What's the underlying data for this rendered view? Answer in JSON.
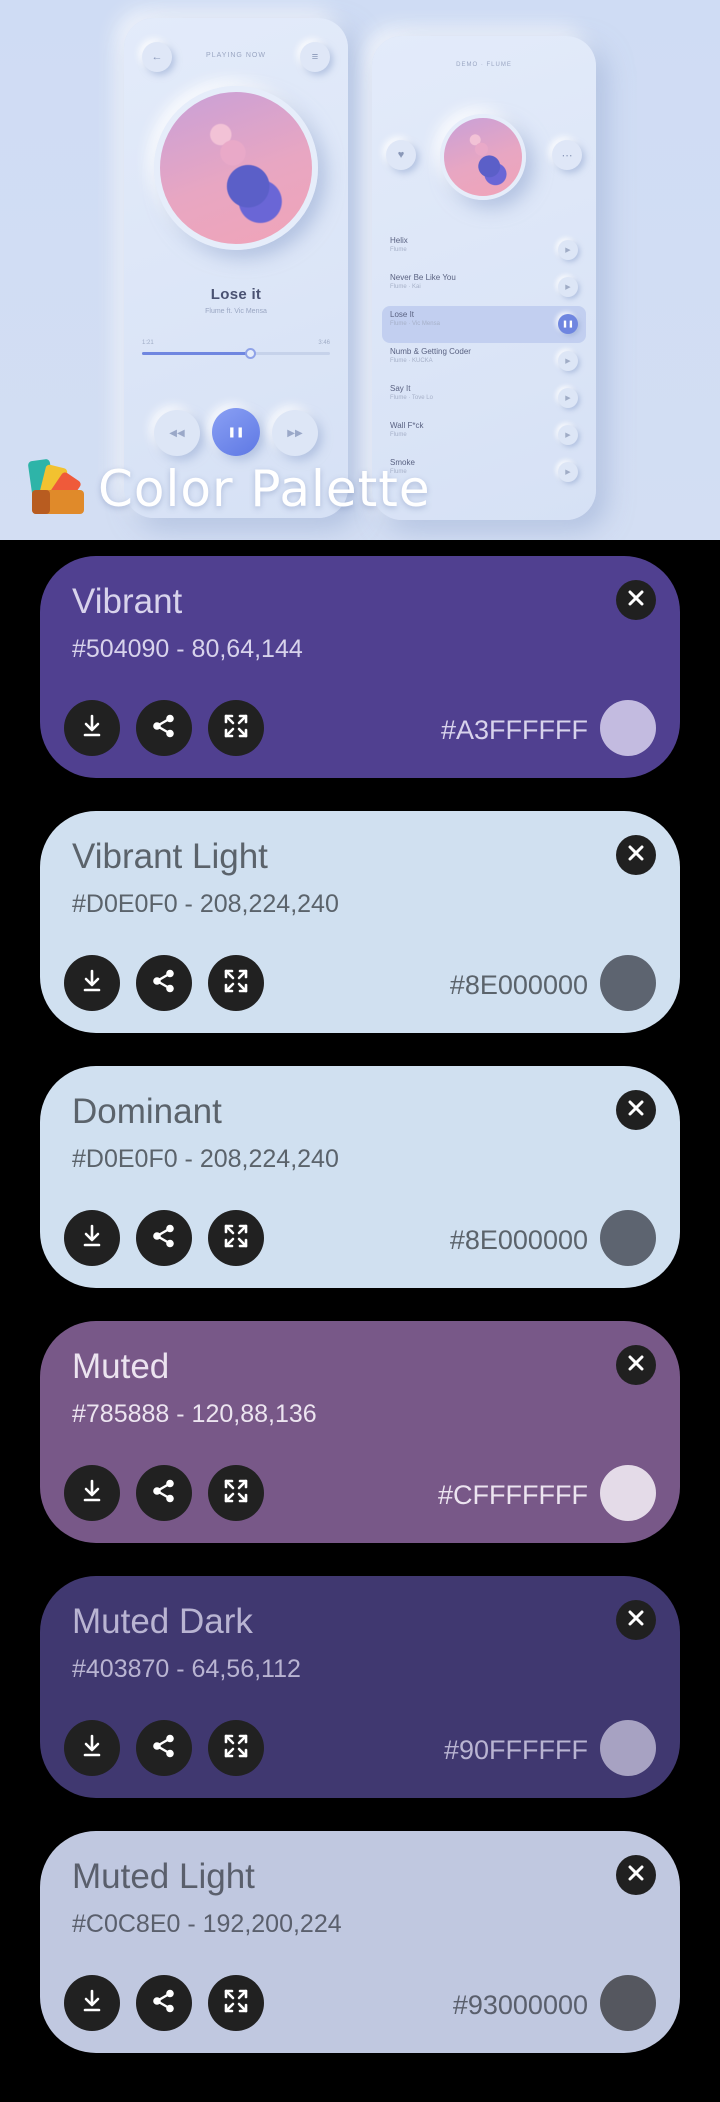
{
  "hero": {
    "now_playing_title": "PLAYING NOW",
    "song": "Lose it",
    "artist": "Flume ft. Vic Mensa",
    "time_elapsed": "1:21",
    "time_total": "3:46",
    "progress": 0.56,
    "playlist_header": "DEMO · FLUME",
    "playlist": [
      {
        "name": "Helix",
        "sub": "Flume",
        "active": false
      },
      {
        "name": "Never Be Like You",
        "sub": "Flume · Kai",
        "active": false
      },
      {
        "name": "Lose It",
        "sub": "Flume · Vic Mensa",
        "active": true
      },
      {
        "name": "Numb & Getting Coder",
        "sub": "Flume · KUCKA",
        "active": false
      },
      {
        "name": "Say It",
        "sub": "Flume · Tove Lo",
        "active": false
      },
      {
        "name": "Wall F*ck",
        "sub": "Flume",
        "active": false
      },
      {
        "name": "Smoke",
        "sub": "Flume",
        "active": false
      }
    ],
    "brand_text": "Color Palette"
  },
  "cards": [
    {
      "title": "Vibrant",
      "hex": "#504090 - 80,64,144",
      "argb": "#A3FFFFFF",
      "bg": "#504090",
      "text": "#d8d3ec",
      "swatch": "#c3bbe0"
    },
    {
      "title": "Vibrant Light",
      "hex": "#D0E0F0 - 208,224,240",
      "argb": "#8E000000",
      "bg": "#d0e0f0",
      "text": "#5b636b",
      "swatch": "#5d6470"
    },
    {
      "title": "Dominant",
      "hex": "#D0E0F0 - 208,224,240",
      "argb": "#8E000000",
      "bg": "#d0e0f0",
      "text": "#5b636b",
      "swatch": "#5d6470"
    },
    {
      "title": "Muted",
      "hex": "#785888 - 120,88,136",
      "argb": "#CFFFFFFF",
      "bg": "#785888",
      "text": "#ece4f0",
      "swatch": "#e4dbe8"
    },
    {
      "title": "Muted Dark",
      "hex": "#403870 - 64,56,112",
      "argb": "#90FFFFFF",
      "bg": "#403870",
      "text": "#b9b4d2",
      "swatch": "#a7a2c2"
    },
    {
      "title": "Muted Light",
      "hex": "#C0C8E0 - 192,200,224",
      "argb": "#93000000",
      "bg": "#c0c8e0",
      "text": "#5a5f6c",
      "swatch": "#55575f"
    }
  ]
}
